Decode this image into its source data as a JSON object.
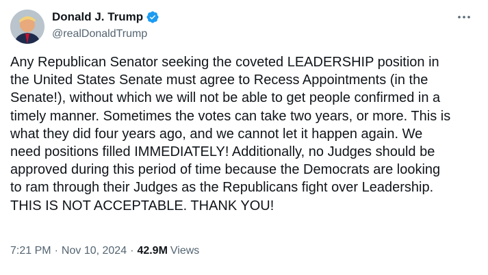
{
  "author": {
    "display_name": "Donald J. Trump",
    "handle": "@realDonaldTrump",
    "verified": true,
    "verified_color": "#1d9bf0"
  },
  "tweet": {
    "text": "Any Republican Senator seeking the coveted LEADERSHIP position in\nthe United States Senate must agree to Recess Appointments (in the\nSenate!), without which we will not be able to get people confirmed in a\ntimely manner. Sometimes the votes can take two years, or more. This is\nwhat they did four years ago, and we cannot let it happen again. We\nneed positions filled IMMEDIATELY! Additionally, no Judges should be\napproved during this period of time because the Democrats are looking\nto ram through their Judges as the Republicans fight over Leadership.\nTHIS IS NOT ACCEPTABLE. THANK YOU!"
  },
  "meta": {
    "time": "7:21 PM",
    "date": "Nov 10, 2024",
    "separator": "·",
    "views_count": "42.9M",
    "views_label": "Views"
  },
  "icons": {
    "more": "more-horizontal-icon",
    "verified": "verified-badge-icon"
  }
}
